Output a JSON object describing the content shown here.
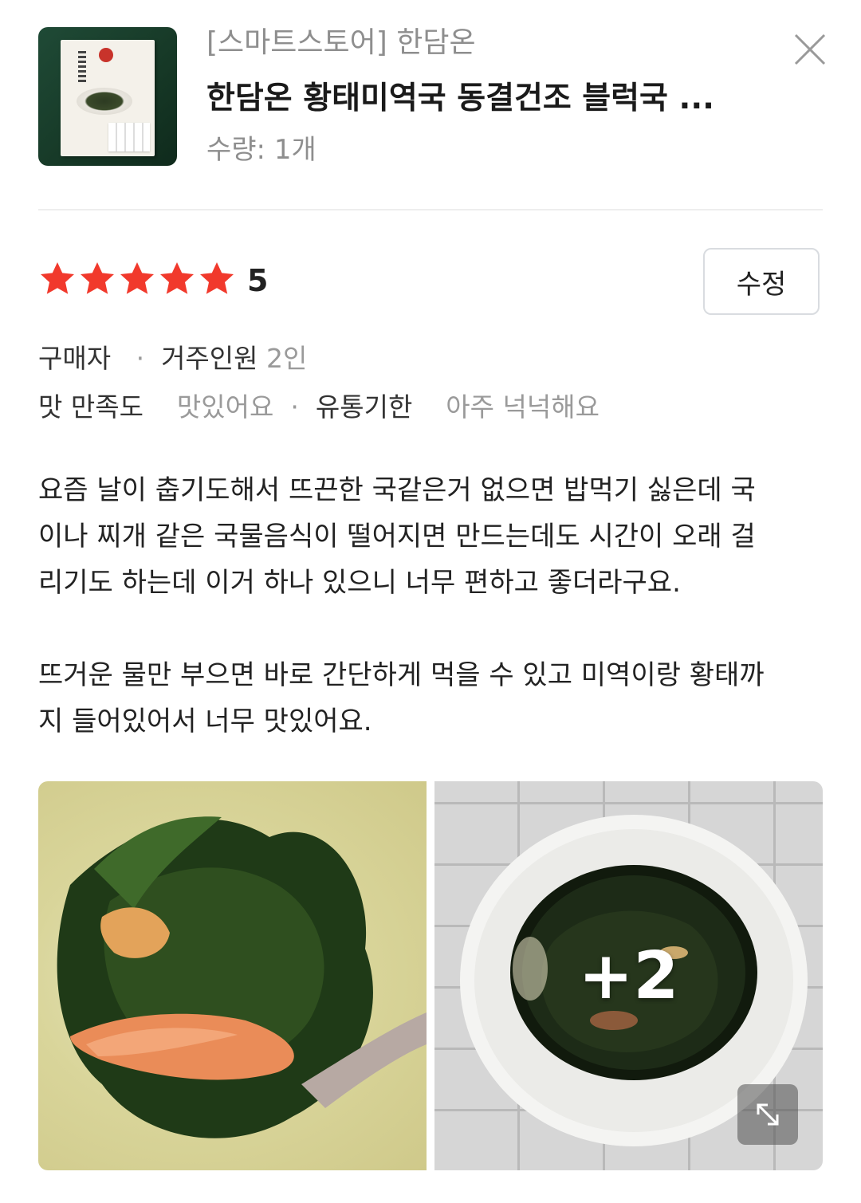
{
  "product": {
    "store": "[스마트스토어] 한담온",
    "title": "한담온 황태미역국 동결건조 블럭국 ...",
    "quantity": "수량: 1개",
    "thumbnail_icon": "product-package-image"
  },
  "rating": {
    "stars": 5,
    "max_stars": 5,
    "score_text": "5",
    "star_color": "#f1392c"
  },
  "edit_button": {
    "label": "수정"
  },
  "reviewer": {
    "buyer_label": "구매자",
    "household_label": "거주인원",
    "household_value": "2인"
  },
  "attributes": {
    "taste_label": "맛 만족도",
    "taste_value": "맛있어요",
    "expiry_label": "유통기한",
    "expiry_value": "아주 넉넉해요"
  },
  "review_text": "요즘 날이 춥기도해서 뜨끈한 국같은거 없으면 밥먹기 싫은데 국\n이나 찌개 같은 국물음식이 떨어지면 만드는데도 시간이 오래 걸\n리기도 하는데 이거 하나 있으니 너무 편하고 좋더라구요.\n\n뜨거운 물만 부으면 바로 간단하게 먹을 수 있고 미역이랑 황태까\n지 들어있어서 너무 맛있어요.",
  "photos": {
    "more_count_text": "+2",
    "expand_icon": "expand-arrow-icon"
  }
}
